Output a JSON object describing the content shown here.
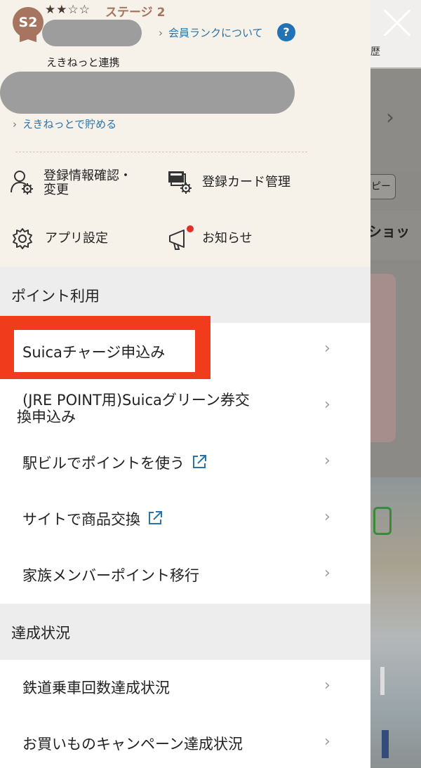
{
  "backdrop": {
    "history_fragment": "歴",
    "button_fragment": "ピー",
    "section_fragment": "ショッ"
  },
  "profile": {
    "stars": "★★☆☆",
    "stage": "ステージ 2",
    "badge": "S2",
    "rank_link": "会員ランクについて",
    "help": "?",
    "ekinet_label": "えきねっと連携",
    "ekinet_link": "えきねっとで貯める"
  },
  "menu": {
    "registration": [
      "登録情報確認・",
      "変更"
    ],
    "card": "登録カード管理",
    "app_settings": "アプリ設定",
    "notice": "お知らせ"
  },
  "sections": [
    {
      "title": "ポイント利用",
      "items": [
        {
          "label": "Suicaチャージ申込み"
        },
        {
          "label_lines": [
            "(JRE POINT用)Suicaグリーン券交",
            "換申込み"
          ]
        },
        {
          "label": "駅ビルでポイントを使う",
          "external": true
        },
        {
          "label": "サイトで商品交換",
          "external": true
        },
        {
          "label": "家族メンバーポイント移行"
        }
      ]
    },
    {
      "title": "達成状況",
      "items": [
        {
          "label": "鉄道乗車回数達成状況"
        },
        {
          "label": "お買いものキャンペーン達成状況"
        }
      ]
    }
  ],
  "chevron": "›",
  "colors": {
    "accent_link": "#2b73a8",
    "highlight": "#f03b1c",
    "badge": "#a7755f",
    "notice_dot": "#e52d27"
  }
}
